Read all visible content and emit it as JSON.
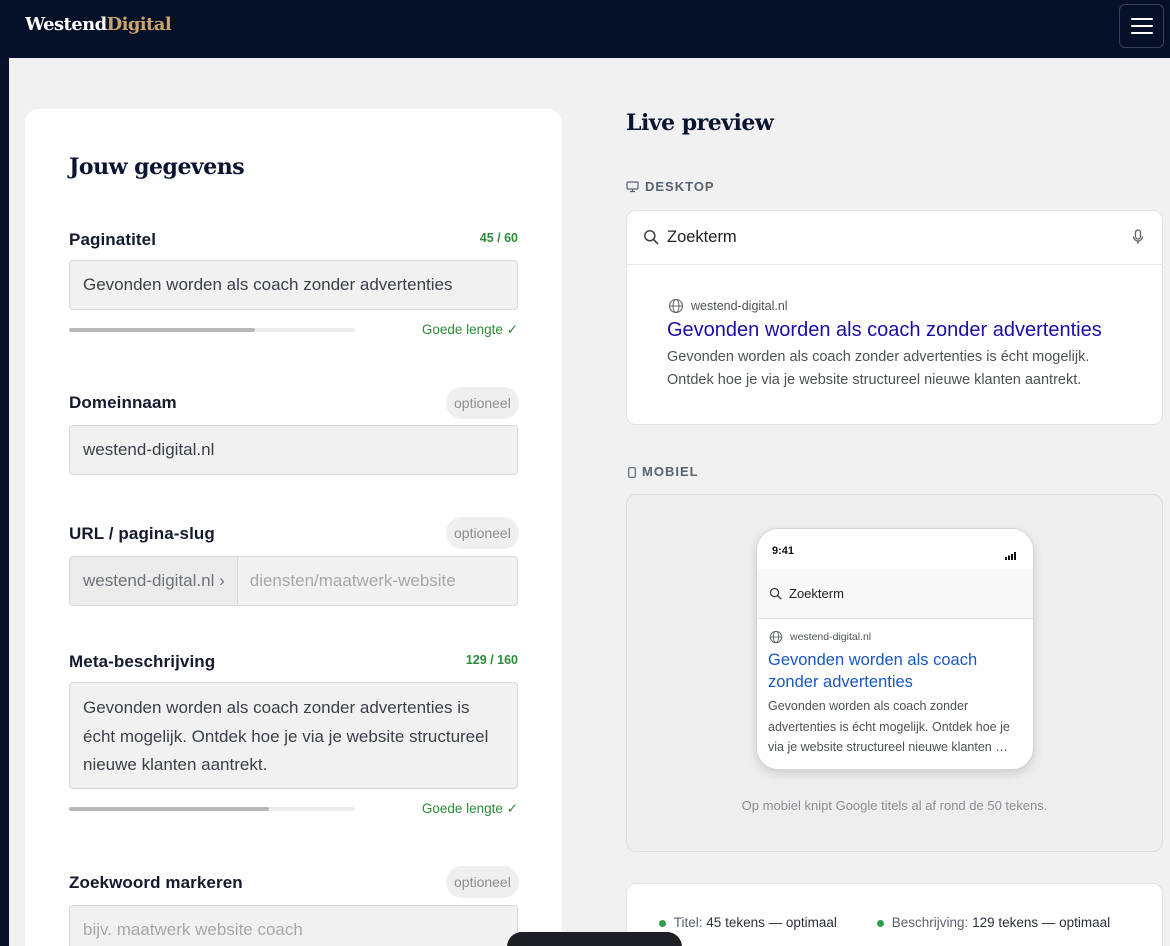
{
  "brand": {
    "name_part1": "Westend",
    "name_part2": "Digital"
  },
  "form": {
    "heading": "Jouw gegevens",
    "title_field": {
      "label": "Paginatitel",
      "counter": "45 / 60",
      "value": "Gevonden worden als coach zonder advertenties",
      "length_status": "Goede lengte ✓",
      "progress": 0.65
    },
    "domain_field": {
      "label": "Domeinnaam",
      "badge": "optioneel",
      "value": "westend-digital.nl"
    },
    "url_field": {
      "label": "URL / pagina-slug",
      "badge": "optioneel",
      "prefix": "westend-digital.nl ›",
      "placeholder": "diensten/maatwerk-website"
    },
    "meta_field": {
      "label": "Meta-beschrijving",
      "counter": "129 / 160",
      "value": "Gevonden worden als coach zonder advertenties is écht mogelijk. Ontdek hoe je via je website structureel nieuwe klanten aantrekt.",
      "length_status": "Goede lengte ✓",
      "progress": 0.7
    },
    "keyword_field": {
      "label": "Zoekwoord markeren",
      "badge": "optioneel",
      "placeholder": "bijv. maatwerk website coach"
    }
  },
  "preview": {
    "heading": "Live preview",
    "desktop": {
      "caption": "DESKTOP",
      "search_query": "Zoekterm",
      "result_domain": "westend-digital.nl",
      "result_title": "Gevonden worden als coach zonder advertenties",
      "result_description": "Gevonden worden als coach zonder advertenties is écht mogelijk. Ontdek hoe je via je website structureel nieuwe klanten aantrekt."
    },
    "mobile": {
      "caption": "MOBIEL",
      "time": "9:41",
      "search_query": "Zoekterm",
      "result_domain": "westend-digital.nl",
      "result_title": "Gevonden worden als coach zonder advertenties",
      "result_description": "Gevonden worden als coach zonder advertenties is écht mogelijk. Ontdek hoe je via je website structureel nieuwe klanten …",
      "note": "Op mobiel knipt Google titels al af rond de 50 tekens."
    },
    "summary": {
      "title_label": "Titel:",
      "title_value": "45 tekens — optimaal",
      "desc_label": "Beschrijving:",
      "desc_value": "129 tekens — optimaal"
    }
  },
  "colors": {
    "navbar": "#061029",
    "accent_gold": "#c7a56a",
    "ok_green": "#2e8b3a",
    "serp_link": "#1a0dab"
  }
}
